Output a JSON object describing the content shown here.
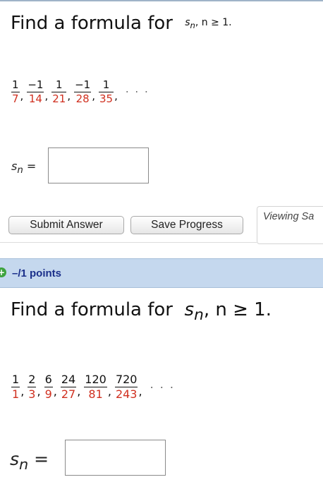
{
  "question1": {
    "prompt": "Find a formula for",
    "var_s": "s",
    "var_n": "n",
    "condition": ", n ≥ 1.",
    "sequence": [
      {
        "num": "1",
        "den": "7"
      },
      {
        "num": "−1",
        "den": "14"
      },
      {
        "num": "1",
        "den": "21"
      },
      {
        "num": "−1",
        "den": "28"
      },
      {
        "num": "1",
        "den": "35"
      }
    ],
    "ellipsis": ". . .",
    "answer_label_s": "s",
    "answer_label_n": "n",
    "answer_label_eq": " =",
    "answer_value": ""
  },
  "buttons": {
    "submit": "Submit Answer",
    "save": "Save Progress"
  },
  "viewing_label": "Viewing Sa",
  "question2_header": {
    "points": "–/1 points",
    "plus_icon": "+"
  },
  "question2": {
    "prompt": "Find a formula for",
    "var_s": "s",
    "var_n": "n",
    "condition": ", n ≥ 1.",
    "sequence": [
      {
        "num": "1",
        "den": "1"
      },
      {
        "num": "2",
        "den": "3"
      },
      {
        "num": "6",
        "den": "9"
      },
      {
        "num": "24",
        "den": "27"
      },
      {
        "num": "120",
        "den": "81"
      },
      {
        "num": "720",
        "den": "243"
      }
    ],
    "ellipsis": ". . .",
    "answer_label_s": "s",
    "answer_label_n": "n",
    "answer_label_eq": " =",
    "answer_value": ""
  },
  "colors": {
    "denominator": "#d03020",
    "points_bar": "#c5d8ee",
    "points_text": "#1a2f8a",
    "plus_icon": "#3ea33e"
  }
}
